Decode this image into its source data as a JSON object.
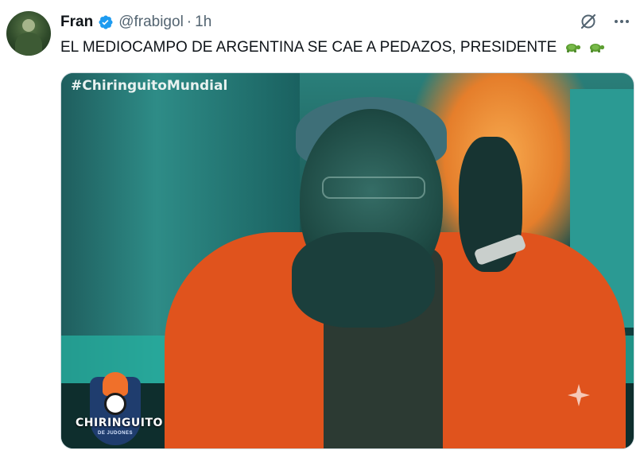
{
  "tweet": {
    "author": {
      "display_name": "Fran",
      "handle": "@frabigol",
      "verified": true
    },
    "separator": "·",
    "time": "1h",
    "text": "EL MEDIOCAMPO DE ARGENTINA SE CAE A PEDAZOS, PRESIDENTE",
    "emoji": [
      "turtle-icon",
      "turtle-icon"
    ],
    "media": {
      "overlay_hashtag": "#ChiringuitoMundial",
      "logo_text": "CHIRINGUITO",
      "logo_subtext": "DE JUDONES"
    }
  },
  "icons": {
    "verified": "verified-badge-icon",
    "grok": "grok-icon",
    "more": "more-icon",
    "sparkle": "sparkle-icon"
  },
  "colors": {
    "text": "#0f1419",
    "secondary": "#536471",
    "verified": "#1d9bf0",
    "border": "#cfd9de"
  }
}
